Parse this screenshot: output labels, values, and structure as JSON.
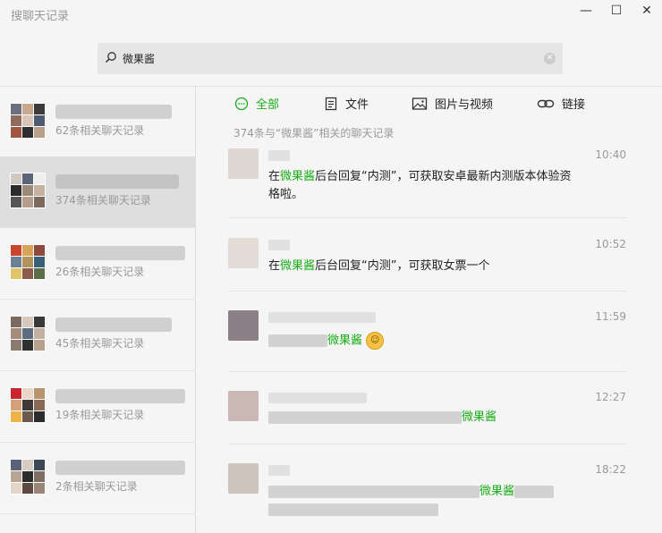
{
  "window": {
    "title": "搜聊天记录",
    "minimize": "—",
    "maximize": "☐",
    "close": "✕"
  },
  "search": {
    "value": "微果酱"
  },
  "sidebar": {
    "items": [
      {
        "count_label": "62条相关聊天记录"
      },
      {
        "count_label": "374条相关聊天记录",
        "active": true
      },
      {
        "count_label": "26条相关聊天记录"
      },
      {
        "count_label": "45条相关聊天记录"
      },
      {
        "count_label": "19条相关聊天记录"
      },
      {
        "count_label": "2条相关聊天记录"
      }
    ]
  },
  "tabs": [
    {
      "label": "全部",
      "icon": "chat-bubble-icon",
      "active": true
    },
    {
      "label": "文件",
      "icon": "document-icon"
    },
    {
      "label": "图片与视频",
      "icon": "image-icon"
    },
    {
      "label": "链接",
      "icon": "link-icon"
    }
  ],
  "summary": "374条与“微果酱”相关的聊天记录",
  "results": [
    {
      "time": "10:40",
      "pre": "在",
      "hl": "微果酱",
      "post": "后台回复“内测”，可获取安卓最新内测版本体验资格啦。"
    },
    {
      "time": "10:52",
      "pre": "在",
      "hl": "微果酱",
      "post": "后台回复“内测”，可获取女票一个"
    },
    {
      "time": "11:59",
      "hl": "微果酱"
    },
    {
      "time": "12:27",
      "hl": "微果酱"
    },
    {
      "time": "18:22",
      "hl": "微果酱"
    }
  ],
  "colors": {
    "accent": "#1aad19",
    "muted": "#999999"
  }
}
